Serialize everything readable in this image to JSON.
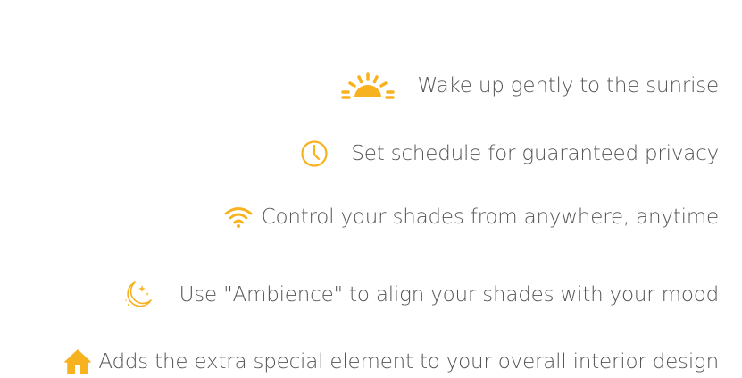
{
  "accent_color": "#f7b21f",
  "text_color": "#555555",
  "features": [
    {
      "icon": "sunrise-icon",
      "text": "Wake up gently to the sunrise"
    },
    {
      "icon": "clock-icon",
      "text": "Set schedule for guaranteed privacy"
    },
    {
      "icon": "wifi-icon",
      "text": "Control your shades from anywhere, anytime"
    },
    {
      "icon": "moon-stars-icon",
      "text": "Use \"Ambience\" to align your shades with your mood"
    },
    {
      "icon": "home-icon",
      "text": "Adds the extra special element to your overall interior design"
    }
  ]
}
